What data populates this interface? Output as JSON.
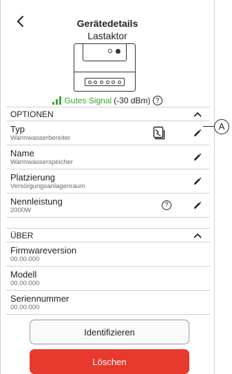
{
  "header": {
    "title": "Gerätedetails",
    "subtitle": "Lastaktor"
  },
  "signal": {
    "quality": "Gutes Signal",
    "value": "(-30 dBm)",
    "help_glyph": "?",
    "color": "#3aa435"
  },
  "options": {
    "heading": "OPTIONEN",
    "rows": [
      {
        "label": "Typ",
        "value": "Warmwasserbereiter"
      },
      {
        "label": "Name",
        "value": "Warmwasserspeicher"
      },
      {
        "label": "Platzierung",
        "value": "Versorgungsanlagenraum"
      },
      {
        "label": "Nennleistung",
        "value": "2000W"
      }
    ],
    "help_glyph": "?"
  },
  "about": {
    "heading": "ÜBER",
    "rows": [
      {
        "label": "Firmwareversion",
        "value": "00.00.000"
      },
      {
        "label": "Modell",
        "value": "00.00.000"
      },
      {
        "label": "Seriennummer",
        "value": "00.00.000"
      }
    ]
  },
  "callout": {
    "label": "A"
  },
  "actions": {
    "identify_label": "Identifizieren",
    "delete_label": "Löschen",
    "delete_color": "#e8392f"
  },
  "icons": {
    "back": "chevron-left-icon",
    "collapse": "chevron-up-icon",
    "edit": "pencil-icon",
    "type": "water-heater-icon",
    "help": "help-circle-icon",
    "signal": "signal-bars-icon"
  }
}
